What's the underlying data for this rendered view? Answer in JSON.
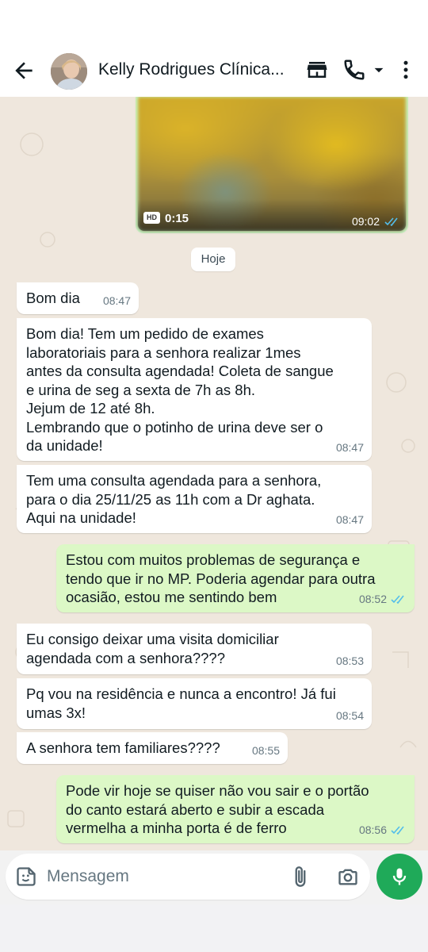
{
  "header": {
    "contact_name": "Kelly Rodrigues Clínica...",
    "icons": [
      "back-arrow-icon",
      "store-icon",
      "phone-icon",
      "dropdown-arrow-icon",
      "more-vertical-icon"
    ]
  },
  "video": {
    "hd_label": "HD",
    "duration": "0:15",
    "time": "09:02",
    "status": "read"
  },
  "date_chip": "Hoje",
  "messages": [
    {
      "dir": "in",
      "text": "Bom dia",
      "time": "08:47"
    },
    {
      "dir": "in",
      "text": "Bom dia! Tem um pedido de exames\nlaboratoriais para a senhora realizar 1mes\nantes da consulta agendada! Coleta de sangue\ne urina de seg a sexta de 7h as 8h.\nJejum de 12 até 8h.\nLembrando que o potinho de urina deve ser o\nda unidade!",
      "time": "08:47"
    },
    {
      "dir": "in",
      "text": "Tem uma consulta agendada para a senhora,\npara o dia 25/11/25 as 11h com a Dr aghata.\nAqui na unidade!",
      "time": "08:47"
    },
    {
      "dir": "out",
      "text": "Estou com muitos problemas de segurança e\ntendo que ir no MP. Poderia agendar para outra\nocasião, estou me sentindo bem",
      "time": "08:52",
      "status": "read"
    },
    {
      "dir": "in",
      "text": "Eu consigo deixar uma visita domiciliar\nagendada com a senhora????",
      "time": "08:53"
    },
    {
      "dir": "in",
      "text": "Pq vou na residência e nunca a encontro! Já fui\numas 3x!",
      "time": "08:54"
    },
    {
      "dir": "in",
      "text": "A senhora tem familiares????",
      "time": "08:55"
    },
    {
      "dir": "out",
      "text": "Pode vir hoje se quiser não vou sair e o portão\ndo canto estará aberto e subir a escada\nvermelha a minha porta é de ferro",
      "time": "08:56",
      "status": "read"
    }
  ],
  "composer": {
    "placeholder": "Mensagem",
    "icons": [
      "sticker-icon",
      "attach-icon",
      "camera-icon",
      "mic-icon"
    ]
  },
  "colors": {
    "outgoing_bubble": "#dcf8c6",
    "incoming_bubble": "#ffffff",
    "chat_background": "#efe7dd",
    "read_ticks": "#53bdeb",
    "mic_button": "#1faa59"
  }
}
